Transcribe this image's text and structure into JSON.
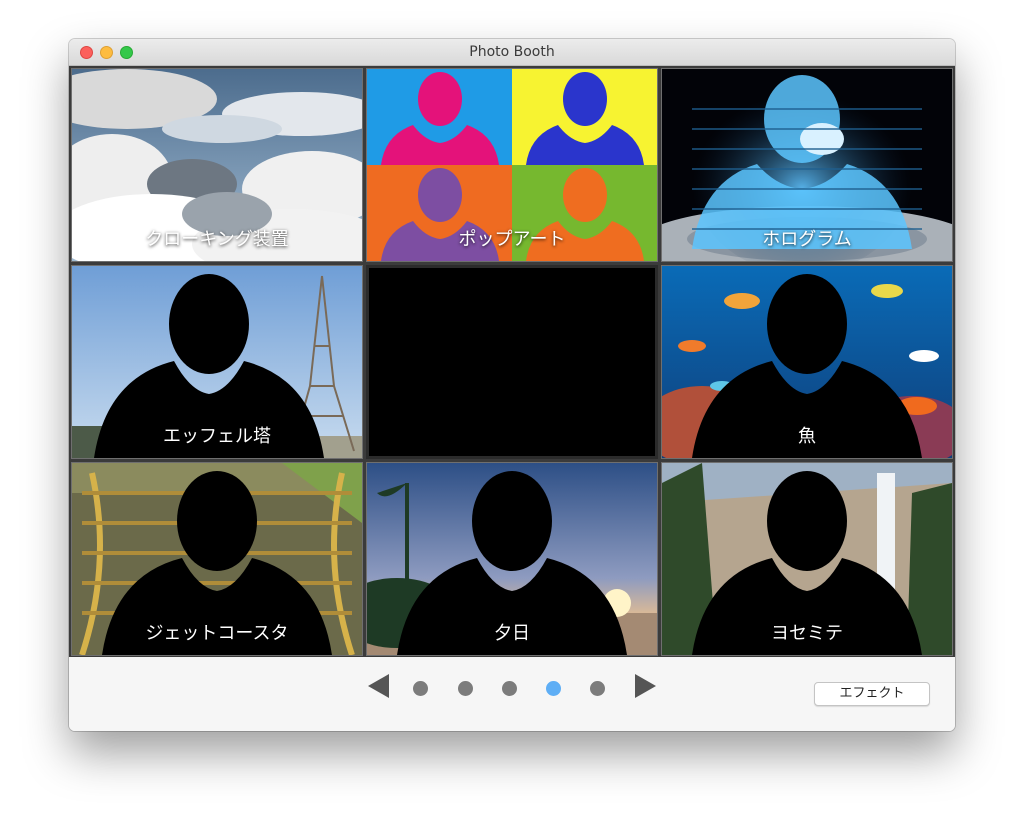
{
  "window": {
    "title": "Photo Booth"
  },
  "effects": [
    {
      "label": "クローキング装置",
      "kind": "clouds"
    },
    {
      "label": "ポップアート",
      "kind": "popart"
    },
    {
      "label": "ホログラム",
      "kind": "hologram"
    },
    {
      "label": "エッフェル塔",
      "kind": "eiffel"
    },
    {
      "label": "",
      "kind": "normal"
    },
    {
      "label": "魚",
      "kind": "fish"
    },
    {
      "label": "ジェットコースタ",
      "kind": "rollercoaster"
    },
    {
      "label": "夕日",
      "kind": "sunset"
    },
    {
      "label": "ヨセミテ",
      "kind": "yosemite"
    }
  ],
  "pager": {
    "page_count": 5,
    "active_index": 3
  },
  "toolbar": {
    "effect_button_label": "エフェクト"
  },
  "colors": {
    "active_dot": "#5eaef5",
    "inactive_dot": "#7c7c7c"
  }
}
